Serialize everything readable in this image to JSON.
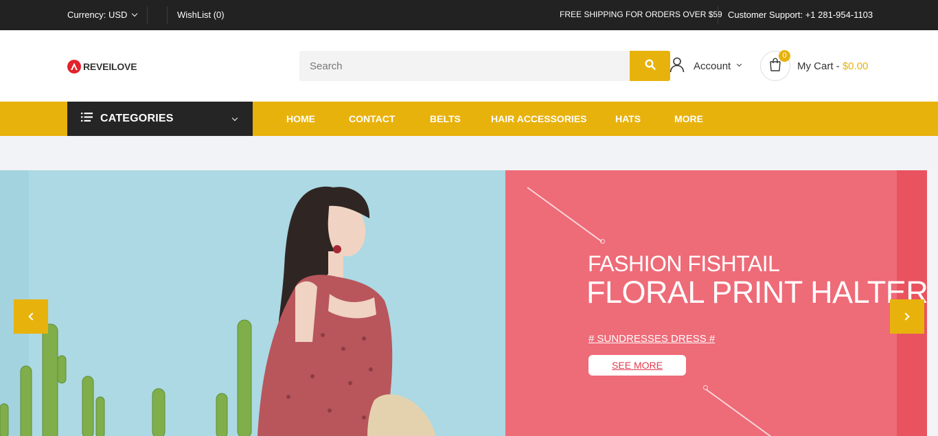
{
  "topbar": {
    "currency": "Currency: USD",
    "wishlist": "WishList (0)",
    "shipping": "FREE SHIPPING FOR ORDERS OVER $59",
    "support": "Customer Support: +1 281-954-1103"
  },
  "header": {
    "logo_text": "REVEILOVE",
    "search_placeholder": "Search",
    "account_label": "Account",
    "cart_count": "0",
    "cart_label": "My Cart - ",
    "cart_total": "$0.00"
  },
  "nav": {
    "categories_label": "CATEGORIES",
    "links": [
      "HOME",
      "CONTACT",
      "BELTS",
      "HAIR ACCESSORIES",
      "HATS",
      "MORE"
    ]
  },
  "banner": {
    "subtitle": "FASHION FISHTAIL",
    "title": "FLORAL PRINT HALTER",
    "tag": "# SUNDRESSES DRESS #",
    "cta": "SEE MORE"
  },
  "colors": {
    "accent": "#e8b20d",
    "topbar": "#222222",
    "categories_bg": "#252525",
    "banner_left": "#acd9e3",
    "banner_right": "#ee6b78"
  },
  "icons": [
    "chevron-down-icon",
    "logo-icon",
    "search-icon",
    "user-icon",
    "shopping-bag-icon",
    "menu-lines-icon",
    "chevron-left-icon",
    "chevron-right-icon"
  ]
}
